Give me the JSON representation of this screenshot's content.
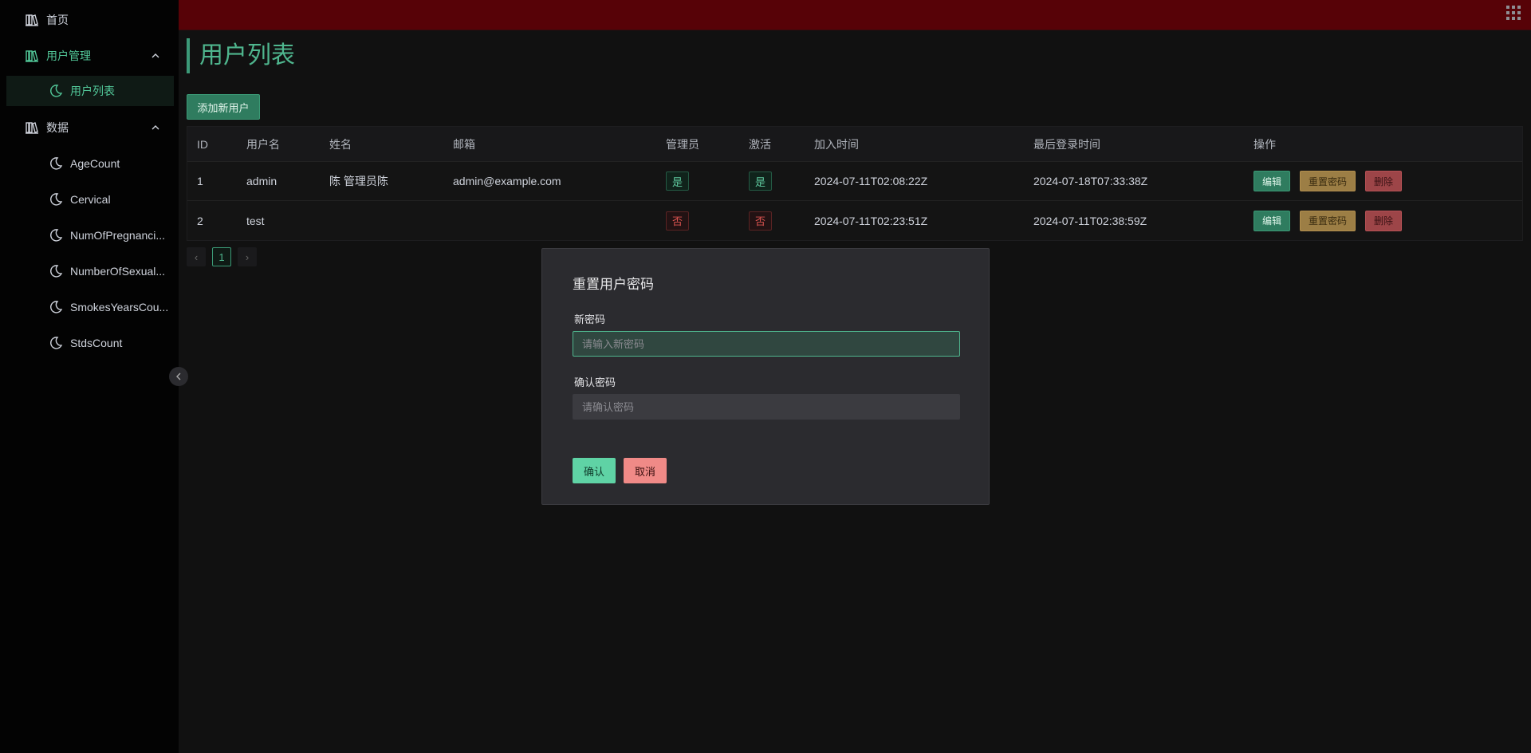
{
  "sidebar": {
    "home": "首页",
    "user_mgmt": "用户管理",
    "user_list": "用户列表",
    "data": "数据",
    "data_items": [
      "AgeCount",
      "Cervical",
      "NumOfPregnanci...",
      "NumberOfSexual...",
      "SmokesYearsCou...",
      "StdsCount"
    ]
  },
  "page": {
    "title": "用户列表",
    "add_button": "添加新用户"
  },
  "table": {
    "columns": [
      "ID",
      "用户名",
      "姓名",
      "邮箱",
      "管理员",
      "激活",
      "加入时间",
      "最后登录时间",
      "操作"
    ],
    "rows": [
      {
        "id": "1",
        "username": "admin",
        "name": "陈 管理员陈",
        "email": "admin@example.com",
        "admin": "是",
        "active": "是",
        "joined": "2024-07-11T02:08:22Z",
        "last_login": "2024-07-18T07:33:38Z"
      },
      {
        "id": "2",
        "username": "test",
        "name": "",
        "email": "",
        "admin": "否",
        "active": "否",
        "joined": "2024-07-11T02:23:51Z",
        "last_login": "2024-07-11T02:38:59Z"
      }
    ],
    "actions": {
      "edit": "编辑",
      "reset": "重置密码",
      "delete": "删除"
    }
  },
  "pagination": {
    "prev": "‹",
    "current": "1",
    "next": "›"
  },
  "modal": {
    "title": "重置用户密码",
    "new_password_label": "新密码",
    "new_password_placeholder": "请输入新密码",
    "confirm_password_label": "确认密码",
    "confirm_password_placeholder": "请确认密码",
    "confirm": "确认",
    "cancel": "取消"
  },
  "colors": {
    "accent": "#4fb68e",
    "topbar": "#570207",
    "warning": "#9c7e45",
    "danger": "#9d4548"
  }
}
